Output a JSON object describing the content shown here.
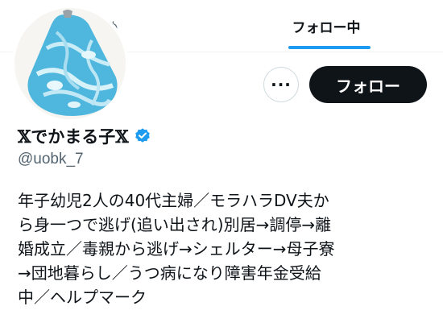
{
  "tabs": {
    "recommend": "すめ",
    "following": "フォロー中"
  },
  "actions": {
    "more": "···",
    "follow": "フォロー"
  },
  "profile": {
    "name": "𝕏でかまる子𝕏",
    "handle": "@uobk_7",
    "bio_lines": [
      "年子幼児2人の40代主婦／モラハラDV夫か",
      "ら身一つで逃げ(追い出され)別居→調停→離",
      "婚成立／毒親から逃げ→シェルター→母子寮",
      "→団地暮らし／うつ病になり障害年金受給",
      "中／ヘルプマーク"
    ]
  },
  "colors": {
    "accent": "#1d9bf0",
    "text": "#0f1419",
    "secondary": "#536471",
    "verified": "#1d9bf0"
  },
  "icons": {
    "verified": "verified-badge-icon",
    "avatar": "larimar-stone-photo"
  }
}
